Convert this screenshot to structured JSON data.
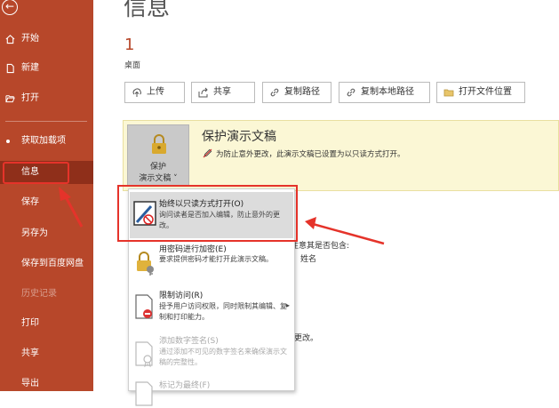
{
  "sidebar": {
    "back_label": "←",
    "items": [
      {
        "label": "开始",
        "icon": "home-icon"
      },
      {
        "label": "新建",
        "icon": "new-file-icon"
      },
      {
        "label": "打开",
        "icon": "folder-open-icon"
      },
      {
        "label": "获取加载项"
      },
      {
        "label": "信息",
        "selected": true
      },
      {
        "label": "保存"
      },
      {
        "label": "另存为"
      },
      {
        "label": "保存到百度网盘"
      },
      {
        "label": "历史记录",
        "disabled": true
      },
      {
        "label": "打印"
      },
      {
        "label": "共享"
      },
      {
        "label": "导出"
      }
    ]
  },
  "main": {
    "title": "信息",
    "file_name": "1",
    "file_location": "桌面",
    "actions": [
      {
        "label": "上传",
        "icon": "upload-icon"
      },
      {
        "label": "共享",
        "icon": "share-icon"
      },
      {
        "label": "复制路径",
        "icon": "link-icon"
      },
      {
        "label": "复制本地路径",
        "icon": "link-icon"
      },
      {
        "label": "打开文件位置",
        "icon": "folder-icon"
      }
    ],
    "protect": {
      "button_line1": "保护",
      "button_line2": "演示文稿 ˅",
      "title": "保护演示文稿",
      "description": "为防止意外更改，此演示文稿已设置为以只读方式打开。"
    },
    "dropdown": [
      {
        "title": "始终以只读方式打开(O)",
        "desc": "询问读者是否加入编辑，防止意外的更改。",
        "icon": "read-only-icon"
      },
      {
        "title": "用密码进行加密(E)",
        "desc": "要求提供密码才能打开此演示文稿。",
        "icon": "encrypt-lock-icon"
      },
      {
        "title": "限制访问(R)",
        "desc": "授予用户访问权限，同时限制其编辑、复制和打印能力。",
        "icon": "restrict-access-icon",
        "has_submenu": true
      },
      {
        "title": "添加数字签名(S)",
        "desc": "通过添加不可见的数字签名来确保演示文稿的完整性。",
        "icon": "digital-signature-icon",
        "muted": true
      },
      {
        "title": "标记为最终(F)",
        "icon": "mark-final-icon",
        "muted": true
      }
    ],
    "background_text": [
      "注意其是否包含:",
      "姓名",
      "更改。"
    ]
  },
  "colors": {
    "sidebar_bg": "#b7472a",
    "sidebar_selected": "#8f2f1a",
    "accent_red": "#e5332a",
    "protect_panel": "#fbf7d5"
  }
}
